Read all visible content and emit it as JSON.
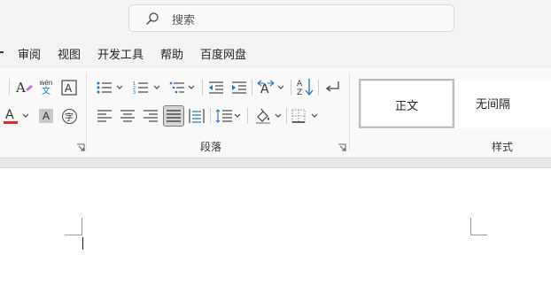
{
  "search": {
    "placeholder": "搜索"
  },
  "menu": {
    "items": [
      "审阅",
      "视图",
      "开发工具",
      "帮助",
      "百度网盘"
    ]
  },
  "ribbon": {
    "font_group": {
      "phonetic_top": "wén",
      "phonetic_bottom": "文",
      "char_shading": "A",
      "enclosed_char": "字",
      "font_color": "#d9302c"
    },
    "paragraph_group": {
      "label": "段落"
    },
    "styles_group": {
      "label": "样式",
      "styles": [
        "正文",
        "无间隔"
      ]
    }
  }
}
